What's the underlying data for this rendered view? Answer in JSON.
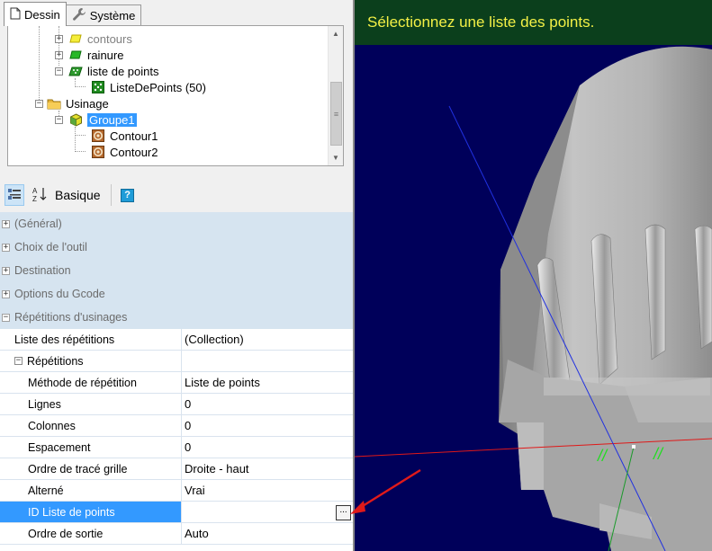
{
  "tabs": [
    {
      "label": "Dessin",
      "icon": "page-icon",
      "active": true
    },
    {
      "label": "Système",
      "icon": "wrench-icon",
      "active": false
    }
  ],
  "tree": {
    "items": [
      {
        "label": "contours",
        "icon": "layer-yellow-icon",
        "expander": "+"
      },
      {
        "label": "rainure",
        "icon": "layer-green-icon",
        "expander": "+"
      },
      {
        "label": "liste de points",
        "icon": "points-layer-icon",
        "expander": "−"
      },
      {
        "label": "ListeDePoints (50)",
        "icon": "point-list-icon"
      },
      {
        "label": "Usinage",
        "icon": "folder-icon",
        "expander": "−"
      },
      {
        "label": "Groupe1",
        "icon": "group-cube-icon",
        "expander": "−",
        "selected": true
      },
      {
        "label": "Contour1",
        "icon": "contour-icon"
      },
      {
        "label": "Contour2",
        "icon": "contour-icon"
      }
    ]
  },
  "toolbar": {
    "basique_label": "Basique",
    "help_label": "?"
  },
  "properties": {
    "categories": [
      {
        "label": "(Général)",
        "expander": "+"
      },
      {
        "label": "Choix de l'outil",
        "expander": "+"
      },
      {
        "label": "Destination",
        "expander": "+"
      },
      {
        "label": "Options du Gcode",
        "expander": "+"
      },
      {
        "label": "Répétitions d'usinages",
        "expander": "−"
      }
    ],
    "rows": [
      {
        "name": "Liste des répétitions",
        "value": "(Collection)"
      },
      {
        "name": "Répétitions",
        "value": "",
        "expander": "−"
      },
      {
        "name": "Méthode de répétition",
        "value": "Liste de points"
      },
      {
        "name": "Lignes",
        "value": "0"
      },
      {
        "name": "Colonnes",
        "value": "0"
      },
      {
        "name": "Espacement",
        "value": "0"
      },
      {
        "name": "Ordre de tracé grille",
        "value": "Droite - haut"
      },
      {
        "name": "Alterné",
        "value": "Vrai"
      },
      {
        "name": "ID Liste de points",
        "value": "",
        "ellipsis": "...",
        "selected": true
      },
      {
        "name": "Ordre de sortie",
        "value": "Auto"
      }
    ]
  },
  "viewport": {
    "message": "Sélectionnez une liste des points.",
    "constraint_marks": [
      "//",
      "//"
    ],
    "colors": {
      "background": "#00005a",
      "banner": "#0b3f1c",
      "message": "#f3f046",
      "part": "#b0b0b0",
      "axis_x": "#e01818",
      "axis_y": "#1a9a2a",
      "axis_z": "#2030e0",
      "annotation_arrow": "#e01a1a"
    }
  }
}
